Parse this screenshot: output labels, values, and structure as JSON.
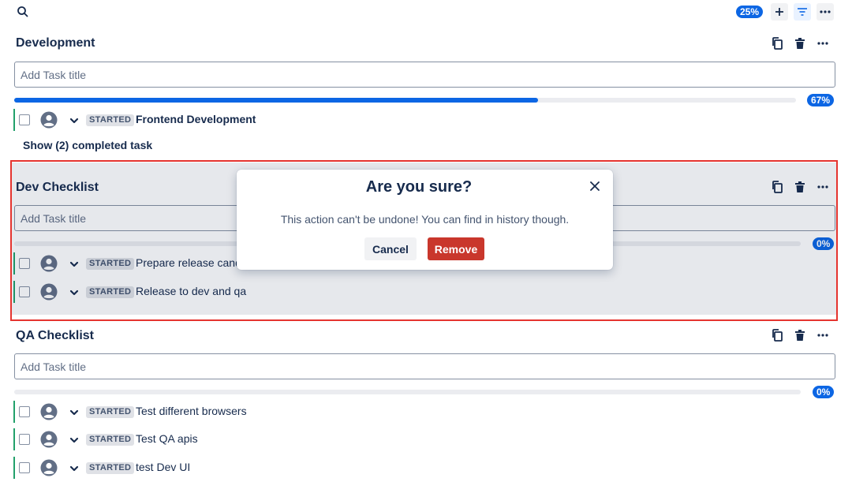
{
  "toolbar": {
    "overall_progress": "25%",
    "icons": [
      "search-icon",
      "plus-icon",
      "filter-icon",
      "more-icon"
    ]
  },
  "sections": [
    {
      "title": "Development",
      "input_placeholder": "Add Task title",
      "progress_label": "67%",
      "progress_fraction": 0.67,
      "tasks": [
        {
          "status": "STARTED",
          "title": "Frontend Development"
        }
      ],
      "show_completed_label": "Show (2) completed task"
    },
    {
      "title": "Dev Checklist",
      "input_placeholder": "Add Task title",
      "progress_label": "0%",
      "progress_fraction": 0,
      "tasks": [
        {
          "status": "STARTED",
          "title": "Prepare release candidate"
        },
        {
          "status": "STARTED",
          "title": "Release to dev and qa"
        }
      ]
    },
    {
      "title": "QA Checklist",
      "input_placeholder": "Add Task title",
      "progress_label": "0%",
      "progress_fraction": 0,
      "tasks": [
        {
          "status": "STARTED",
          "title": "Test different browsers"
        },
        {
          "status": "STARTED",
          "title": "Test QA apis"
        },
        {
          "status": "STARTED",
          "title": "test Dev UI"
        }
      ]
    }
  ],
  "dialog": {
    "title": "Are you sure?",
    "message": "This action can't be undone! You can find in history though.",
    "cancel_label": "Cancel",
    "remove_label": "Remove"
  },
  "colors": {
    "accent": "#0c66e4",
    "danger": "#c9372c",
    "task_bar": "#22a06b",
    "highlight_border": "#e5342f"
  }
}
